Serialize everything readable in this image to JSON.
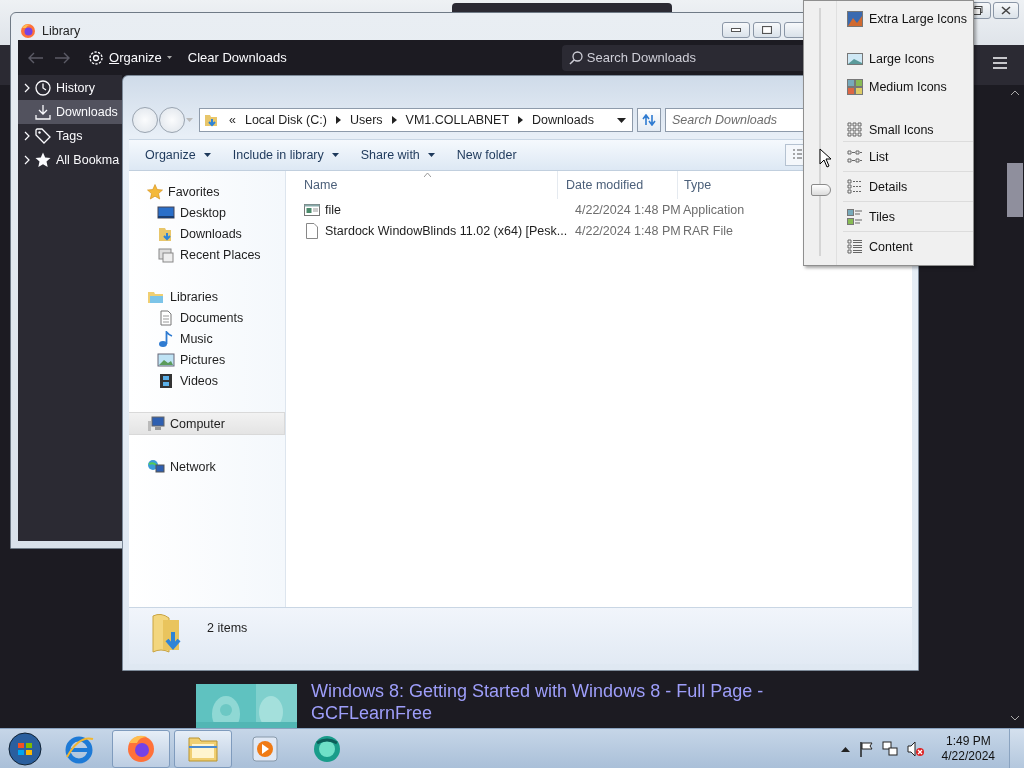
{
  "browser": {
    "result_title": "Windows 8: Getting Started with Windows 8 - Full Page - GCFLearnFree"
  },
  "library": {
    "title": "Library",
    "toolbar": {
      "organize": "Organize",
      "clear": "Clear Downloads",
      "search_placeholder": "Search Downloads"
    },
    "sidebar": [
      {
        "label": "History",
        "selected": false,
        "expandable": true
      },
      {
        "label": "Downloads",
        "selected": true,
        "expandable": false
      },
      {
        "label": "Tags",
        "selected": false,
        "expandable": true
      },
      {
        "label": "All Bookma",
        "selected": false,
        "expandable": true
      }
    ]
  },
  "explorer": {
    "overflow": "«",
    "breadcrumb": [
      "Local Disk (C:)",
      "Users",
      "VM1.COLLABNET",
      "Downloads"
    ],
    "search_placeholder": "Search Downloads",
    "commands": [
      {
        "label": "Organize",
        "dropdown": true
      },
      {
        "label": "Include in library",
        "dropdown": true
      },
      {
        "label": "Share with",
        "dropdown": true
      },
      {
        "label": "New folder",
        "dropdown": false
      }
    ],
    "nav": [
      {
        "label": "Favorites",
        "selected": false,
        "children": [
          {
            "label": "Desktop",
            "selected": false
          },
          {
            "label": "Downloads",
            "selected": false
          },
          {
            "label": "Recent Places",
            "selected": false
          }
        ]
      },
      {
        "label": "Libraries",
        "selected": false,
        "children": [
          {
            "label": "Documents",
            "selected": false
          },
          {
            "label": "Music",
            "selected": false
          },
          {
            "label": "Pictures",
            "selected": false
          },
          {
            "label": "Videos",
            "selected": false
          }
        ]
      },
      {
        "label": "Computer",
        "selected": true
      },
      {
        "label": "Network",
        "selected": false
      }
    ],
    "columns": [
      "Name",
      "Date modified",
      "Type"
    ],
    "rows": [
      {
        "kind": "app",
        "name": "file",
        "date": "4/22/2024 1:48 PM",
        "type": "Application"
      },
      {
        "kind": "document",
        "name": "Stardock WindowBlinds 11.02 (x64) [Pesk...",
        "date": "4/22/2024 1:48 PM",
        "type": "RAR File"
      }
    ],
    "status": "2 items"
  },
  "view_menu": {
    "slider": {
      "level": 0.26
    },
    "items": [
      "Extra Large Icons",
      "Large Icons",
      "Medium Icons",
      "Small Icons",
      "List",
      "Details",
      "Tiles",
      "Content"
    ]
  },
  "taskbar": {
    "apps": [
      {
        "running": false
      },
      {
        "running": true
      },
      {
        "running": true
      },
      {
        "running": false
      },
      {
        "running": false
      }
    ],
    "time": "1:49 PM",
    "date": "4/22/2024"
  }
}
